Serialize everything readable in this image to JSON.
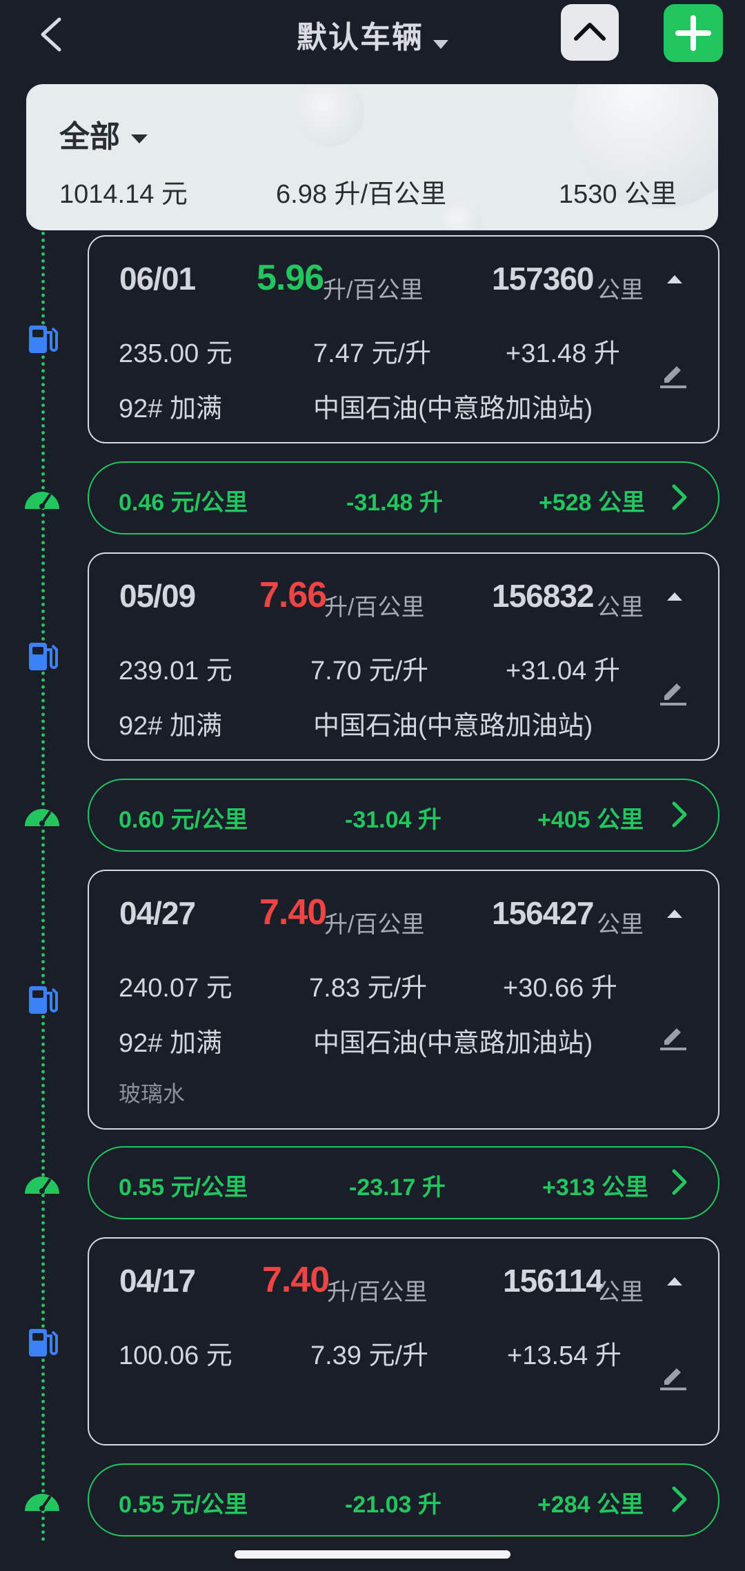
{
  "header": {
    "title": "默认车辆"
  },
  "summary": {
    "filter_label": "全部",
    "total_cost": "1014.14 元",
    "avg_consumption": "6.98 升/百公里",
    "total_distance": "1530 公里"
  },
  "colors": {
    "accent_green": "#22c55e",
    "warning_red": "#ef4444",
    "fuel_icon_blue": "#3b82f6"
  },
  "records": [
    {
      "date": "06/01",
      "consumption": "5.96",
      "consumption_color": "green",
      "consumption_unit": "升/百公里",
      "odometer": "157360",
      "odometer_unit": "公里",
      "cost": "235.00 元",
      "price": "7.47 元/升",
      "volume": "+31.48 升",
      "fuel_type": "92# 加满",
      "station": "中国石油(中意路加油站)",
      "note": ""
    },
    {
      "date": "05/09",
      "consumption": "7.66",
      "consumption_color": "red",
      "consumption_unit": "升/百公里",
      "odometer": "156832",
      "odometer_unit": "公里",
      "cost": "239.01 元",
      "price": "7.70 元/升",
      "volume": "+31.04 升",
      "fuel_type": "92# 加满",
      "station": "中国石油(中意路加油站)",
      "note": ""
    },
    {
      "date": "04/27",
      "consumption": "7.40",
      "consumption_color": "red",
      "consumption_unit": "升/百公里",
      "odometer": "156427",
      "odometer_unit": "公里",
      "cost": "240.07 元",
      "price": "7.83 元/升",
      "volume": "+30.66 升",
      "fuel_type": "92# 加满",
      "station": "中国石油(中意路加油站)",
      "note": "玻璃水"
    },
    {
      "date": "04/17",
      "consumption": "7.40",
      "consumption_color": "red",
      "consumption_unit": "升/百公里",
      "odometer": "156114",
      "odometer_unit": "公里",
      "cost": "100.06 元",
      "price": "7.39 元/升",
      "volume": "+13.54 升",
      "fuel_type": "",
      "station": "",
      "note": ""
    }
  ],
  "segments": [
    {
      "cost_per_km": "0.46 元/公里",
      "fuel_used": "-31.48 升",
      "distance": "+528 公里"
    },
    {
      "cost_per_km": "0.60 元/公里",
      "fuel_used": "-31.04 升",
      "distance": "+405 公里"
    },
    {
      "cost_per_km": "0.55 元/公里",
      "fuel_used": "-23.17 升",
      "distance": "+313 公里"
    },
    {
      "cost_per_km": "0.55 元/公里",
      "fuel_used": "-21.03 升",
      "distance": "+284 公里"
    }
  ]
}
